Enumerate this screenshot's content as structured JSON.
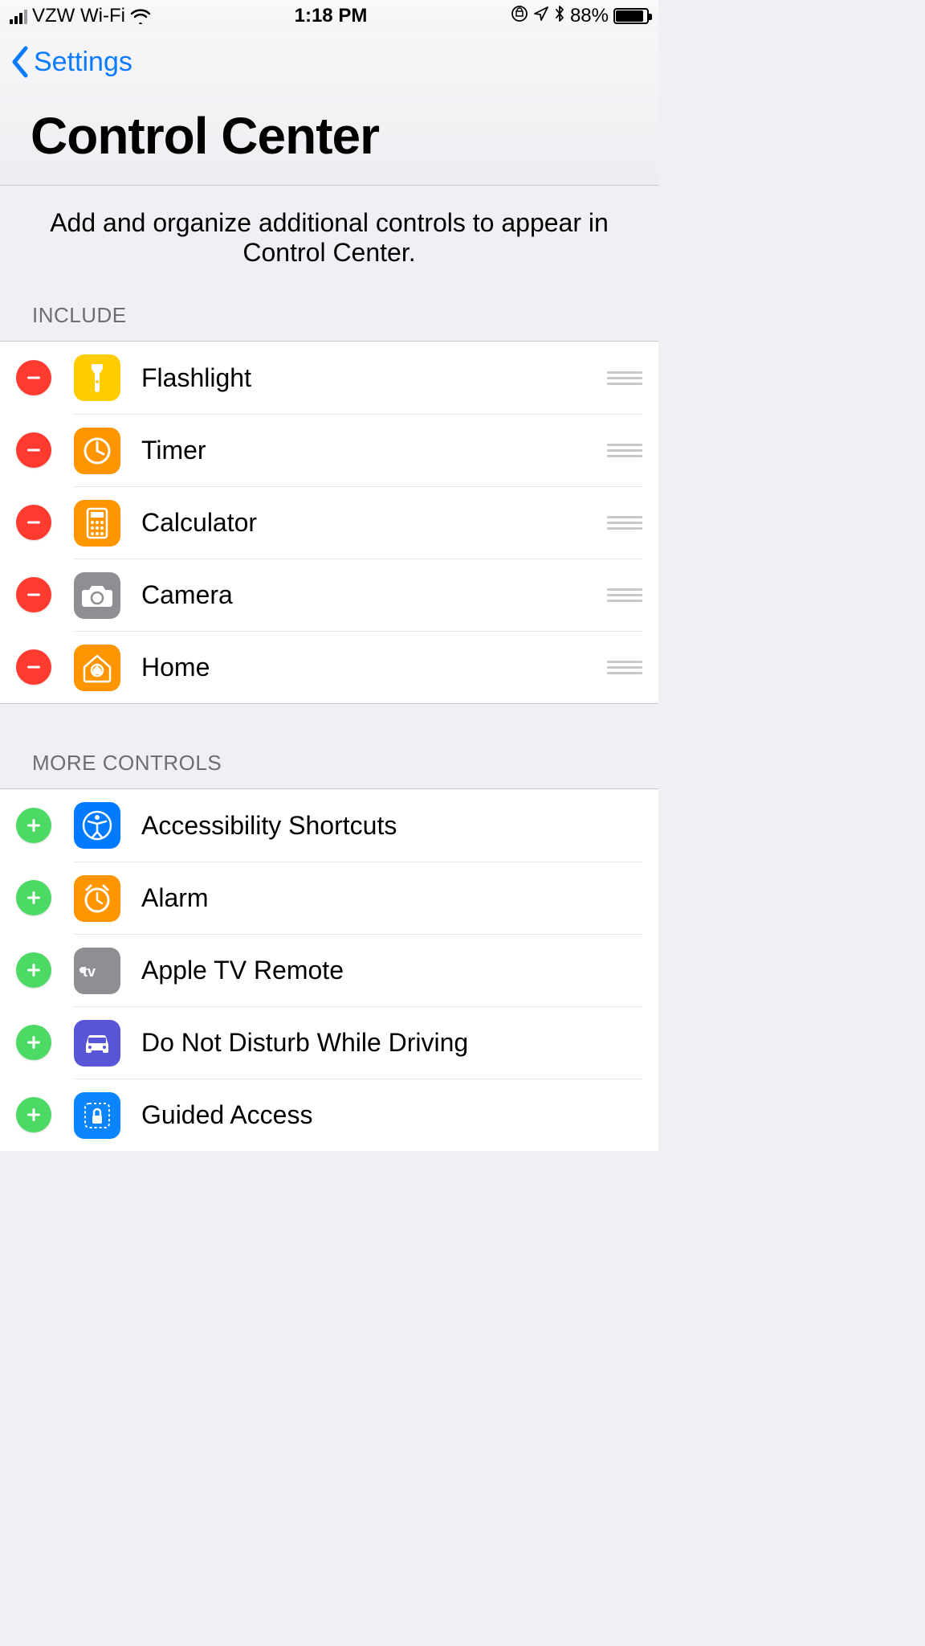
{
  "status": {
    "carrier": "VZW Wi-Fi",
    "time": "1:18 PM",
    "battery_pct": "88%"
  },
  "nav": {
    "back": "Settings",
    "title": "Control Center"
  },
  "description": "Add and organize additional controls to appear in Control Center.",
  "sections": {
    "include": {
      "header": "Include",
      "items": [
        {
          "label": "Flashlight",
          "icon": "flashlight",
          "icon_bg": "bg-yellow"
        },
        {
          "label": "Timer",
          "icon": "timer",
          "icon_bg": "bg-orange"
        },
        {
          "label": "Calculator",
          "icon": "calculator",
          "icon_bg": "bg-orange"
        },
        {
          "label": "Camera",
          "icon": "camera",
          "icon_bg": "bg-gray"
        },
        {
          "label": "Home",
          "icon": "home",
          "icon_bg": "bg-orange"
        }
      ]
    },
    "more": {
      "header": "More Controls",
      "items": [
        {
          "label": "Accessibility Shortcuts",
          "icon": "accessibility",
          "icon_bg": "bg-blue"
        },
        {
          "label": "Alarm",
          "icon": "alarm",
          "icon_bg": "bg-orange"
        },
        {
          "label": "Apple TV Remote",
          "icon": "appletv",
          "icon_bg": "bg-gray"
        },
        {
          "label": "Do Not Disturb While Driving",
          "icon": "car",
          "icon_bg": "bg-purple"
        },
        {
          "label": "Guided Access",
          "icon": "lock",
          "icon_bg": "bg-blue2"
        }
      ]
    }
  }
}
